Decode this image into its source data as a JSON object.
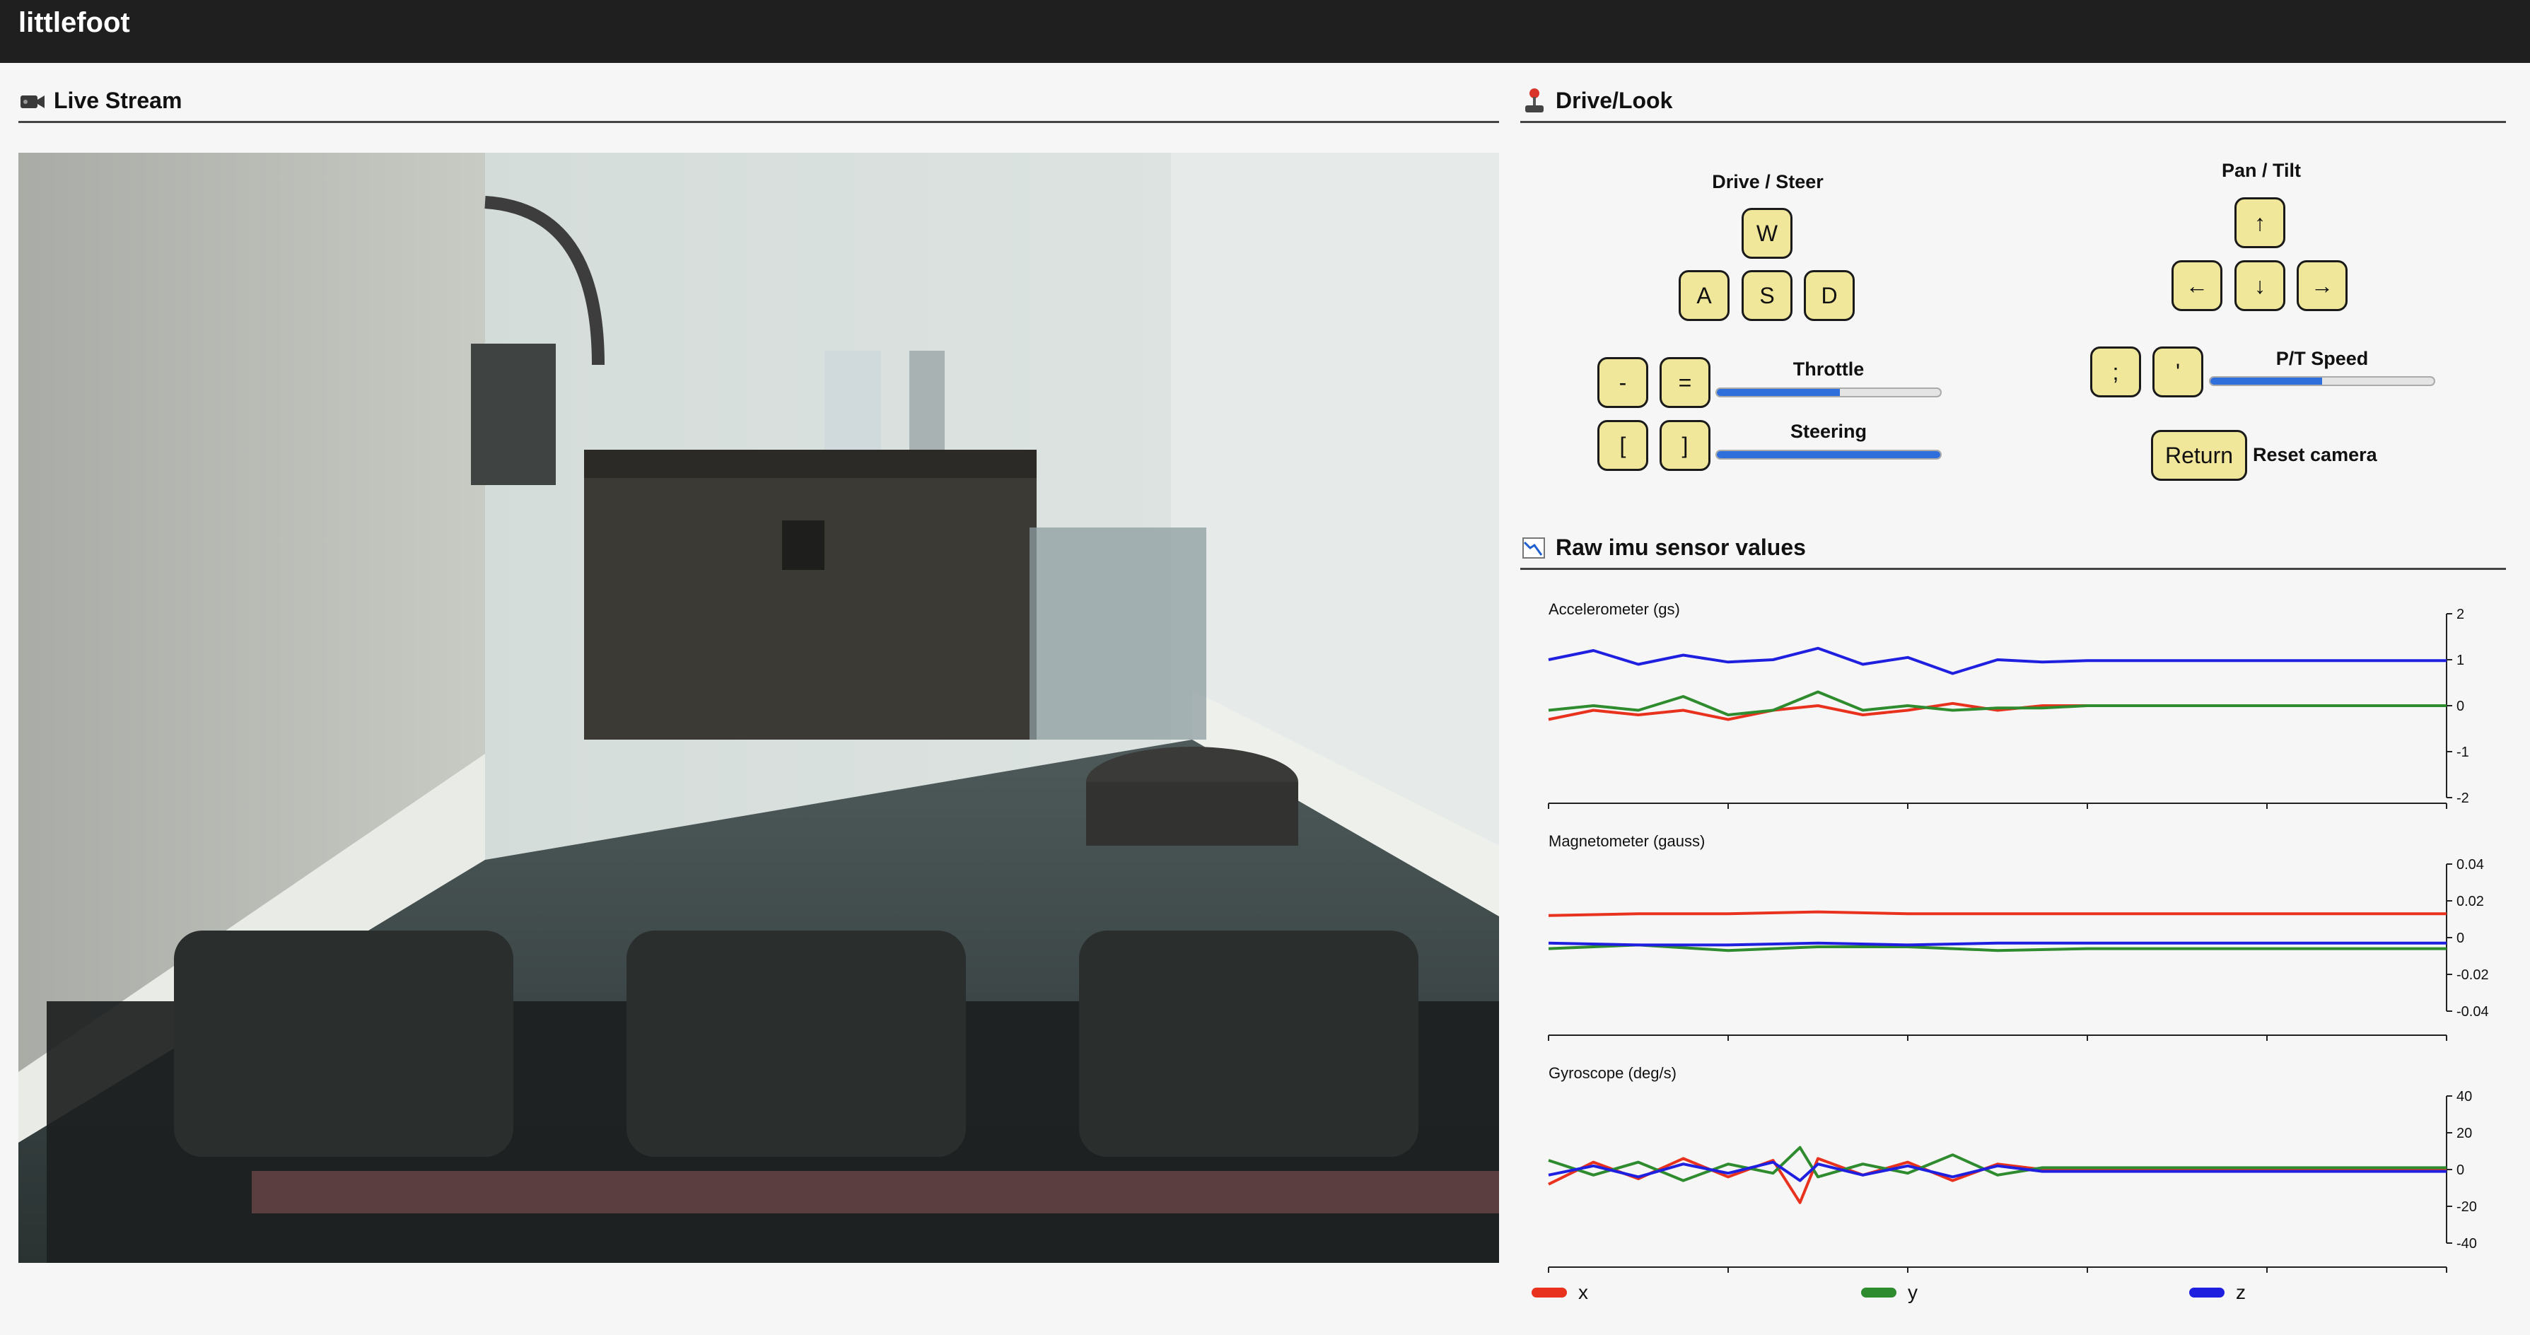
{
  "app": {
    "title": "littlefoot"
  },
  "live_stream": {
    "icon": "video-camera-icon",
    "title": "Live Stream"
  },
  "drive_look": {
    "icon": "joystick-icon",
    "title": "Drive/Look",
    "drive_steer": {
      "title": "Drive / Steer",
      "keys": {
        "w": "W",
        "a": "A",
        "s": "S",
        "d": "D"
      }
    },
    "throttle": {
      "dec": "-",
      "inc": "=",
      "label": "Throttle",
      "level": 0.55
    },
    "steering": {
      "dec": "[",
      "inc": "]",
      "label": "Steering",
      "level": 1.0
    },
    "pan_tilt": {
      "title": "Pan / Tilt",
      "keys": {
        "up": "↑",
        "left": "←",
        "down": "↓",
        "right": "→"
      }
    },
    "pt_speed": {
      "dec": ";",
      "inc": "'",
      "label": "P/T Speed",
      "level": 0.5
    },
    "reset": {
      "key": "Return",
      "label": "Reset camera"
    }
  },
  "imu": {
    "icon": "chart-icon",
    "title": "Raw imu sensor values",
    "legend": [
      {
        "name": "x",
        "color": "#e8321e"
      },
      {
        "name": "y",
        "color": "#2e8b2e"
      },
      {
        "name": "z",
        "color": "#1f1fe0"
      }
    ]
  },
  "chart_data": [
    {
      "type": "line",
      "title": "Accelerometer (gs)",
      "xlabel": "",
      "ylabel": "",
      "xlim": [
        -10,
        0
      ],
      "ylim": [
        -2,
        2
      ],
      "x_ticks": [
        -10,
        -8,
        -6,
        -4,
        -2,
        0
      ],
      "y_ticks": [
        2,
        1,
        0,
        -1,
        -2
      ],
      "grid": false,
      "x": [
        -10,
        -9.5,
        -9,
        -8.5,
        -8,
        -7.5,
        -7,
        -6.5,
        -6,
        -5.5,
        -5,
        -4.5,
        -4,
        -3,
        -2,
        -1,
        0
      ],
      "series": [
        {
          "name": "x",
          "values": [
            -0.3,
            -0.1,
            -0.2,
            -0.1,
            -0.3,
            -0.1,
            0.0,
            -0.2,
            -0.1,
            0.05,
            -0.1,
            0.0,
            0.0,
            0.0,
            0.0,
            0.0,
            0.0
          ]
        },
        {
          "name": "y",
          "values": [
            -0.1,
            0.0,
            -0.1,
            0.2,
            -0.2,
            -0.1,
            0.3,
            -0.1,
            0.0,
            -0.1,
            -0.05,
            -0.05,
            0.0,
            0.0,
            0.0,
            0.0,
            0.0
          ]
        },
        {
          "name": "z",
          "values": [
            1.0,
            1.2,
            0.9,
            1.1,
            0.95,
            1.0,
            1.25,
            0.9,
            1.05,
            0.7,
            1.0,
            0.95,
            0.98,
            0.98,
            0.98,
            0.98,
            0.98
          ]
        }
      ]
    },
    {
      "type": "line",
      "title": "Magnetometer (gauss)",
      "xlabel": "",
      "ylabel": "",
      "xlim": [
        -10,
        0
      ],
      "ylim": [
        -0.05,
        0.05
      ],
      "x_ticks": [
        -10,
        -8,
        -6,
        -4,
        -2,
        0
      ],
      "y_ticks": [
        0.04,
        0.02,
        0,
        -0.02,
        -0.04
      ],
      "grid": false,
      "x": [
        -10,
        -9,
        -8,
        -7,
        -6,
        -5,
        -4,
        -3,
        -2,
        -1,
        0
      ],
      "series": [
        {
          "name": "x",
          "values": [
            0.012,
            0.013,
            0.013,
            0.014,
            0.013,
            0.013,
            0.013,
            0.013,
            0.013,
            0.013,
            0.013
          ]
        },
        {
          "name": "y",
          "values": [
            -0.006,
            -0.004,
            -0.007,
            -0.005,
            -0.005,
            -0.007,
            -0.006,
            -0.006,
            -0.006,
            -0.006,
            -0.006
          ]
        },
        {
          "name": "z",
          "values": [
            -0.003,
            -0.004,
            -0.004,
            -0.003,
            -0.004,
            -0.003,
            -0.003,
            -0.003,
            -0.003,
            -0.003,
            -0.003
          ]
        }
      ]
    },
    {
      "type": "line",
      "title": "Gyroscope (deg/s)",
      "xlabel": "",
      "ylabel": "",
      "xlim": [
        -10,
        0
      ],
      "ylim": [
        -50,
        50
      ],
      "x_ticks": [
        -10,
        -8,
        -6,
        -4,
        -2,
        0
      ],
      "y_ticks": [
        40,
        20,
        0,
        -20,
        -40
      ],
      "grid": false,
      "x": [
        -10,
        -9.5,
        -9,
        -8.5,
        -8,
        -7.5,
        -7.2,
        -7,
        -6.5,
        -6,
        -5.5,
        -5,
        -4.5,
        -4,
        -3,
        -2,
        -1,
        0
      ],
      "series": [
        {
          "name": "x",
          "values": [
            -8,
            4,
            -5,
            6,
            -4,
            5,
            -18,
            6,
            -3,
            4,
            -6,
            3,
            0,
            0,
            0,
            0,
            0,
            0
          ]
        },
        {
          "name": "y",
          "values": [
            5,
            -3,
            4,
            -6,
            3,
            -2,
            12,
            -4,
            3,
            -2,
            8,
            -3,
            1,
            1,
            1,
            1,
            1,
            1
          ]
        },
        {
          "name": "z",
          "values": [
            -3,
            2,
            -4,
            3,
            -2,
            4,
            -6,
            3,
            -3,
            2,
            -4,
            2,
            -1,
            -1,
            -1,
            -1,
            -1,
            -1
          ]
        }
      ]
    }
  ]
}
